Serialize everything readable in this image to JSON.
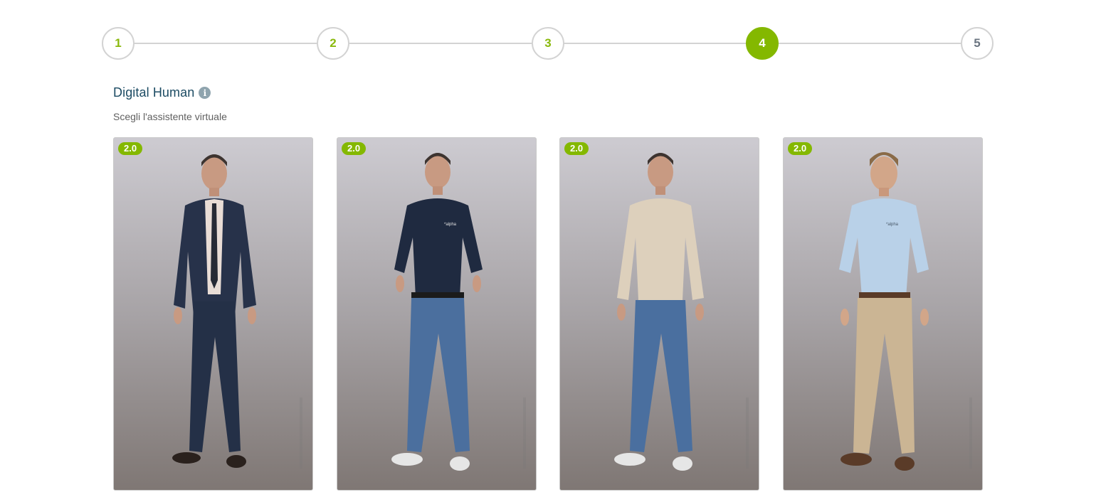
{
  "stepper": {
    "steps": [
      {
        "label": "1",
        "state": "done"
      },
      {
        "label": "2",
        "state": "done"
      },
      {
        "label": "3",
        "state": "done"
      },
      {
        "label": "4",
        "state": "active"
      },
      {
        "label": "5",
        "state": "future"
      }
    ]
  },
  "section": {
    "title": "Digital Human",
    "info_icon": "info-icon",
    "subtitle": "Scegli l'assistente virtuale"
  },
  "avatars": [
    {
      "badge": "2.0",
      "outfit": "navy suit"
    },
    {
      "badge": "2.0",
      "outfit": "navy shirt and jeans"
    },
    {
      "badge": "2.0",
      "outfit": "beige sweater and jeans"
    },
    {
      "badge": "2.0",
      "outfit": "light blue shirt and chinos"
    }
  ],
  "colors": {
    "accent": "#84b800",
    "title": "#1c4b63"
  }
}
